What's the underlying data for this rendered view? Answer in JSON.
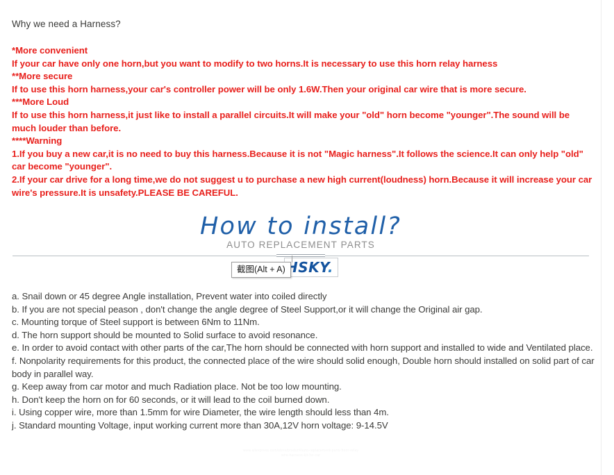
{
  "intro": {
    "title": "Why we need a Harness?",
    "sections": [
      "*More convenient",
      "If your car have only one horn,but you want to modify to two horns.It is necessary to use this horn relay harness",
      "**More secure",
      "If to use this horn harness,your car's controller power will be only 1.6W.Then your original car wire that is more secure.",
      "***More Loud",
      "If to use this horn harness,it just like to install a parallel circuits.It will make your \"old\" horn become \"younger\".The sound will be much louder than before.",
      "****Warning",
      "1.If you buy a new car,it is no need to buy this harness.Because it is not \"Magic harness\".It follows the science.It can only help \"old\" car become \"younger\".",
      "2.If your car drive for a long time,we do not suggest u to purchase a new high current(loudness) horn.Because it will increase your car wire's pressure.It is unsafety.PLEASE BE CAREFUL."
    ]
  },
  "banner": {
    "title": "How to install?",
    "subtitle": "AUTO REPLACEMENT PARTS"
  },
  "logo": {
    "text": "HSKY",
    "dot": "."
  },
  "overlay": {
    "tooltip_label": "截图(Alt + A)"
  },
  "steps": [
    "a. Snail down or 45 degree Angle installation, Prevent water  into coiled directly",
    "b. If you are not special peason , don't change the angle degree of Steel Support,or it will change the Original air gap.",
    "c. Mounting torque of Steel support is between 6Nm to 11Nm.",
    "d. The horn support should be mounted to Solid surface to avoid resonance.",
    "e. In order to avoid contact with other parts of the car,The horn should be connected with horn support and installed to wide and Ventilated place.",
    "f. Nonpolarity requirements for this product, the connected place of the wire should solid enough, Double horn should installed on solid part of car body in parallel way.",
    "g. Keep away from car motor and much Radiation place. Not be too low mounting.",
    "h. Don't keep the horn on for 60 seconds, or it will lead to the coil burned down.",
    "i. Using copper wire, more than 1.5mm for wire Diameter, the wire length should less than 4m.",
    "j. Standard mounting Voltage, input working current more than 30A,12V horn voltage: 9-14.5V"
  ],
  "watermark": {
    "line1": "www.aliexpress.com/store/product/auto-replacement-parts-horn-relay",
    "line2": "wire-harness-kit-for-car"
  },
  "colors": {
    "warning_red": "#e8201c",
    "body_gray": "#3a3a38",
    "brand_blue": "#1f5fa8",
    "subtitle_gray": "#8d8d8d"
  }
}
